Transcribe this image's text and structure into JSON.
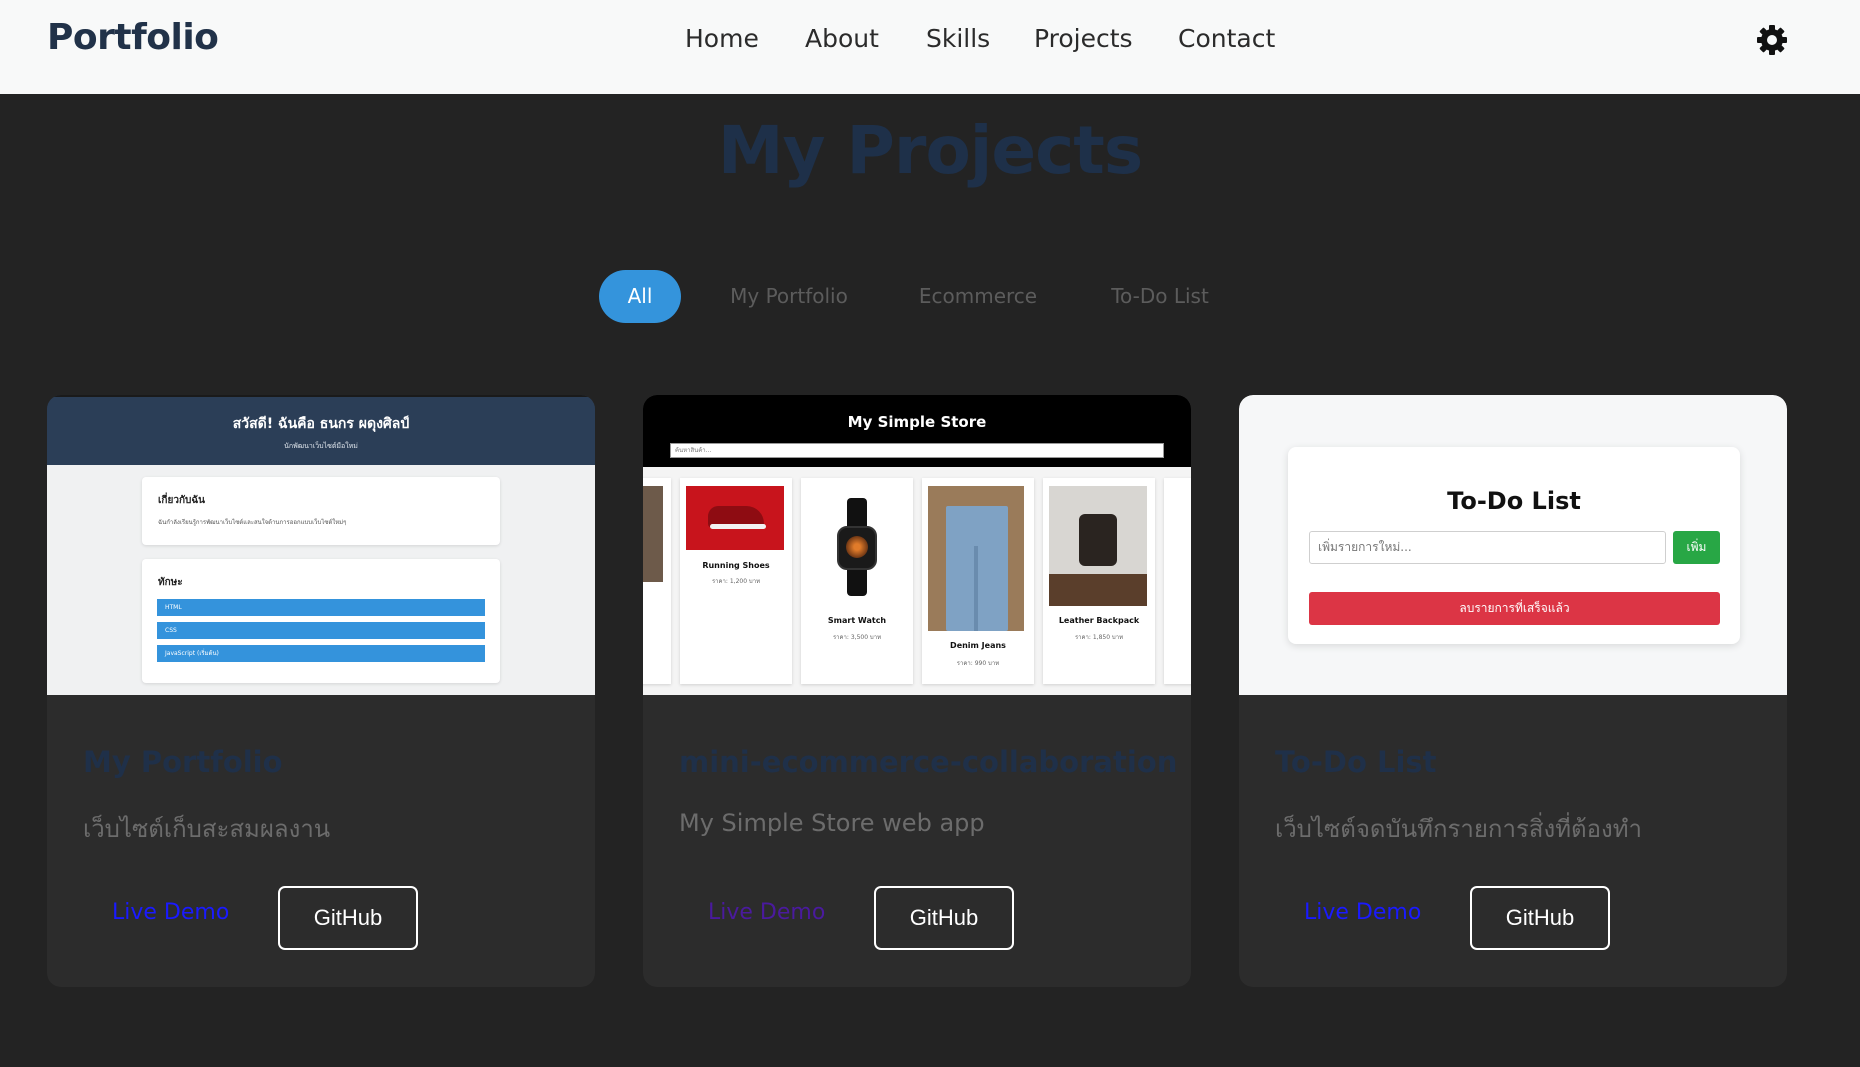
{
  "nav": {
    "brand": "Portfolio",
    "links": [
      "Home",
      "About",
      "Skills",
      "Projects",
      "Contact"
    ],
    "theme_icon": "gear-icon"
  },
  "heading": "My Projects",
  "filters": {
    "items": [
      "All",
      "My Portfolio",
      "Ecommerce",
      "To-Do List"
    ],
    "active": "All"
  },
  "projects": [
    {
      "title": "My Portfolio",
      "description": "เว็บไซต์เก็บสะสมผลงาน",
      "live_label": "Live Demo",
      "github_label": "GitHub",
      "preview": {
        "header_title": "สวัสดี! ฉันคือ ธนกร ผดุงศิลป์",
        "header_subtitle": "นักพัฒนาเว็บไซต์มือใหม่",
        "about_title": "เกี่ยวกับฉัน",
        "about_text": "ฉันกำลังเรียนรู้การพัฒนาเว็บไซต์และสนใจด้านการออกแบบเว็บไซต์ใหม่ๆ",
        "skills_title": "ทักษะ",
        "skills": [
          "HTML",
          "CSS",
          "JavaScript (เริ่มต้น)"
        ]
      }
    },
    {
      "title": "mini-ecommerce-collaboration",
      "description": "My Simple Store web app",
      "live_label": "Live Demo",
      "github_label": "GitHub",
      "preview": {
        "store_title": "My Simple Store",
        "search_placeholder": "ค้นหาสินค้า...",
        "products": [
          {
            "name": "Running Shoes",
            "price": "ราคา: 1,200 บาท"
          },
          {
            "name": "Smart Watch",
            "price": "ราคา: 3,500 บาท"
          },
          {
            "name": "Denim Jeans",
            "price": "ราคา: 990 บาท"
          },
          {
            "name": "Leather Backpack",
            "price": "ราคา: 1,850 บาท"
          }
        ]
      }
    },
    {
      "title": "To-Do List",
      "description": "เว็บไซต์จดบันทึกรายการสิ่งที่ต้องทำ",
      "live_label": "Live Demo",
      "github_label": "GitHub",
      "preview": {
        "app_title": "To-Do List",
        "input_placeholder": "เพิ่มรายการใหม่...",
        "add_label": "เพิ่ม",
        "clear_label": "ลบรายการที่เสร็จแล้ว"
      }
    }
  ],
  "colors": {
    "page_bg": "#232323",
    "nav_bg": "#f8f9f9",
    "card_bg": "#2c2c2c",
    "accent": "#3494dc",
    "title_dark": "#1f3049",
    "link_blue": "#1a1aff",
    "link_visited": "#4a1a9e"
  }
}
